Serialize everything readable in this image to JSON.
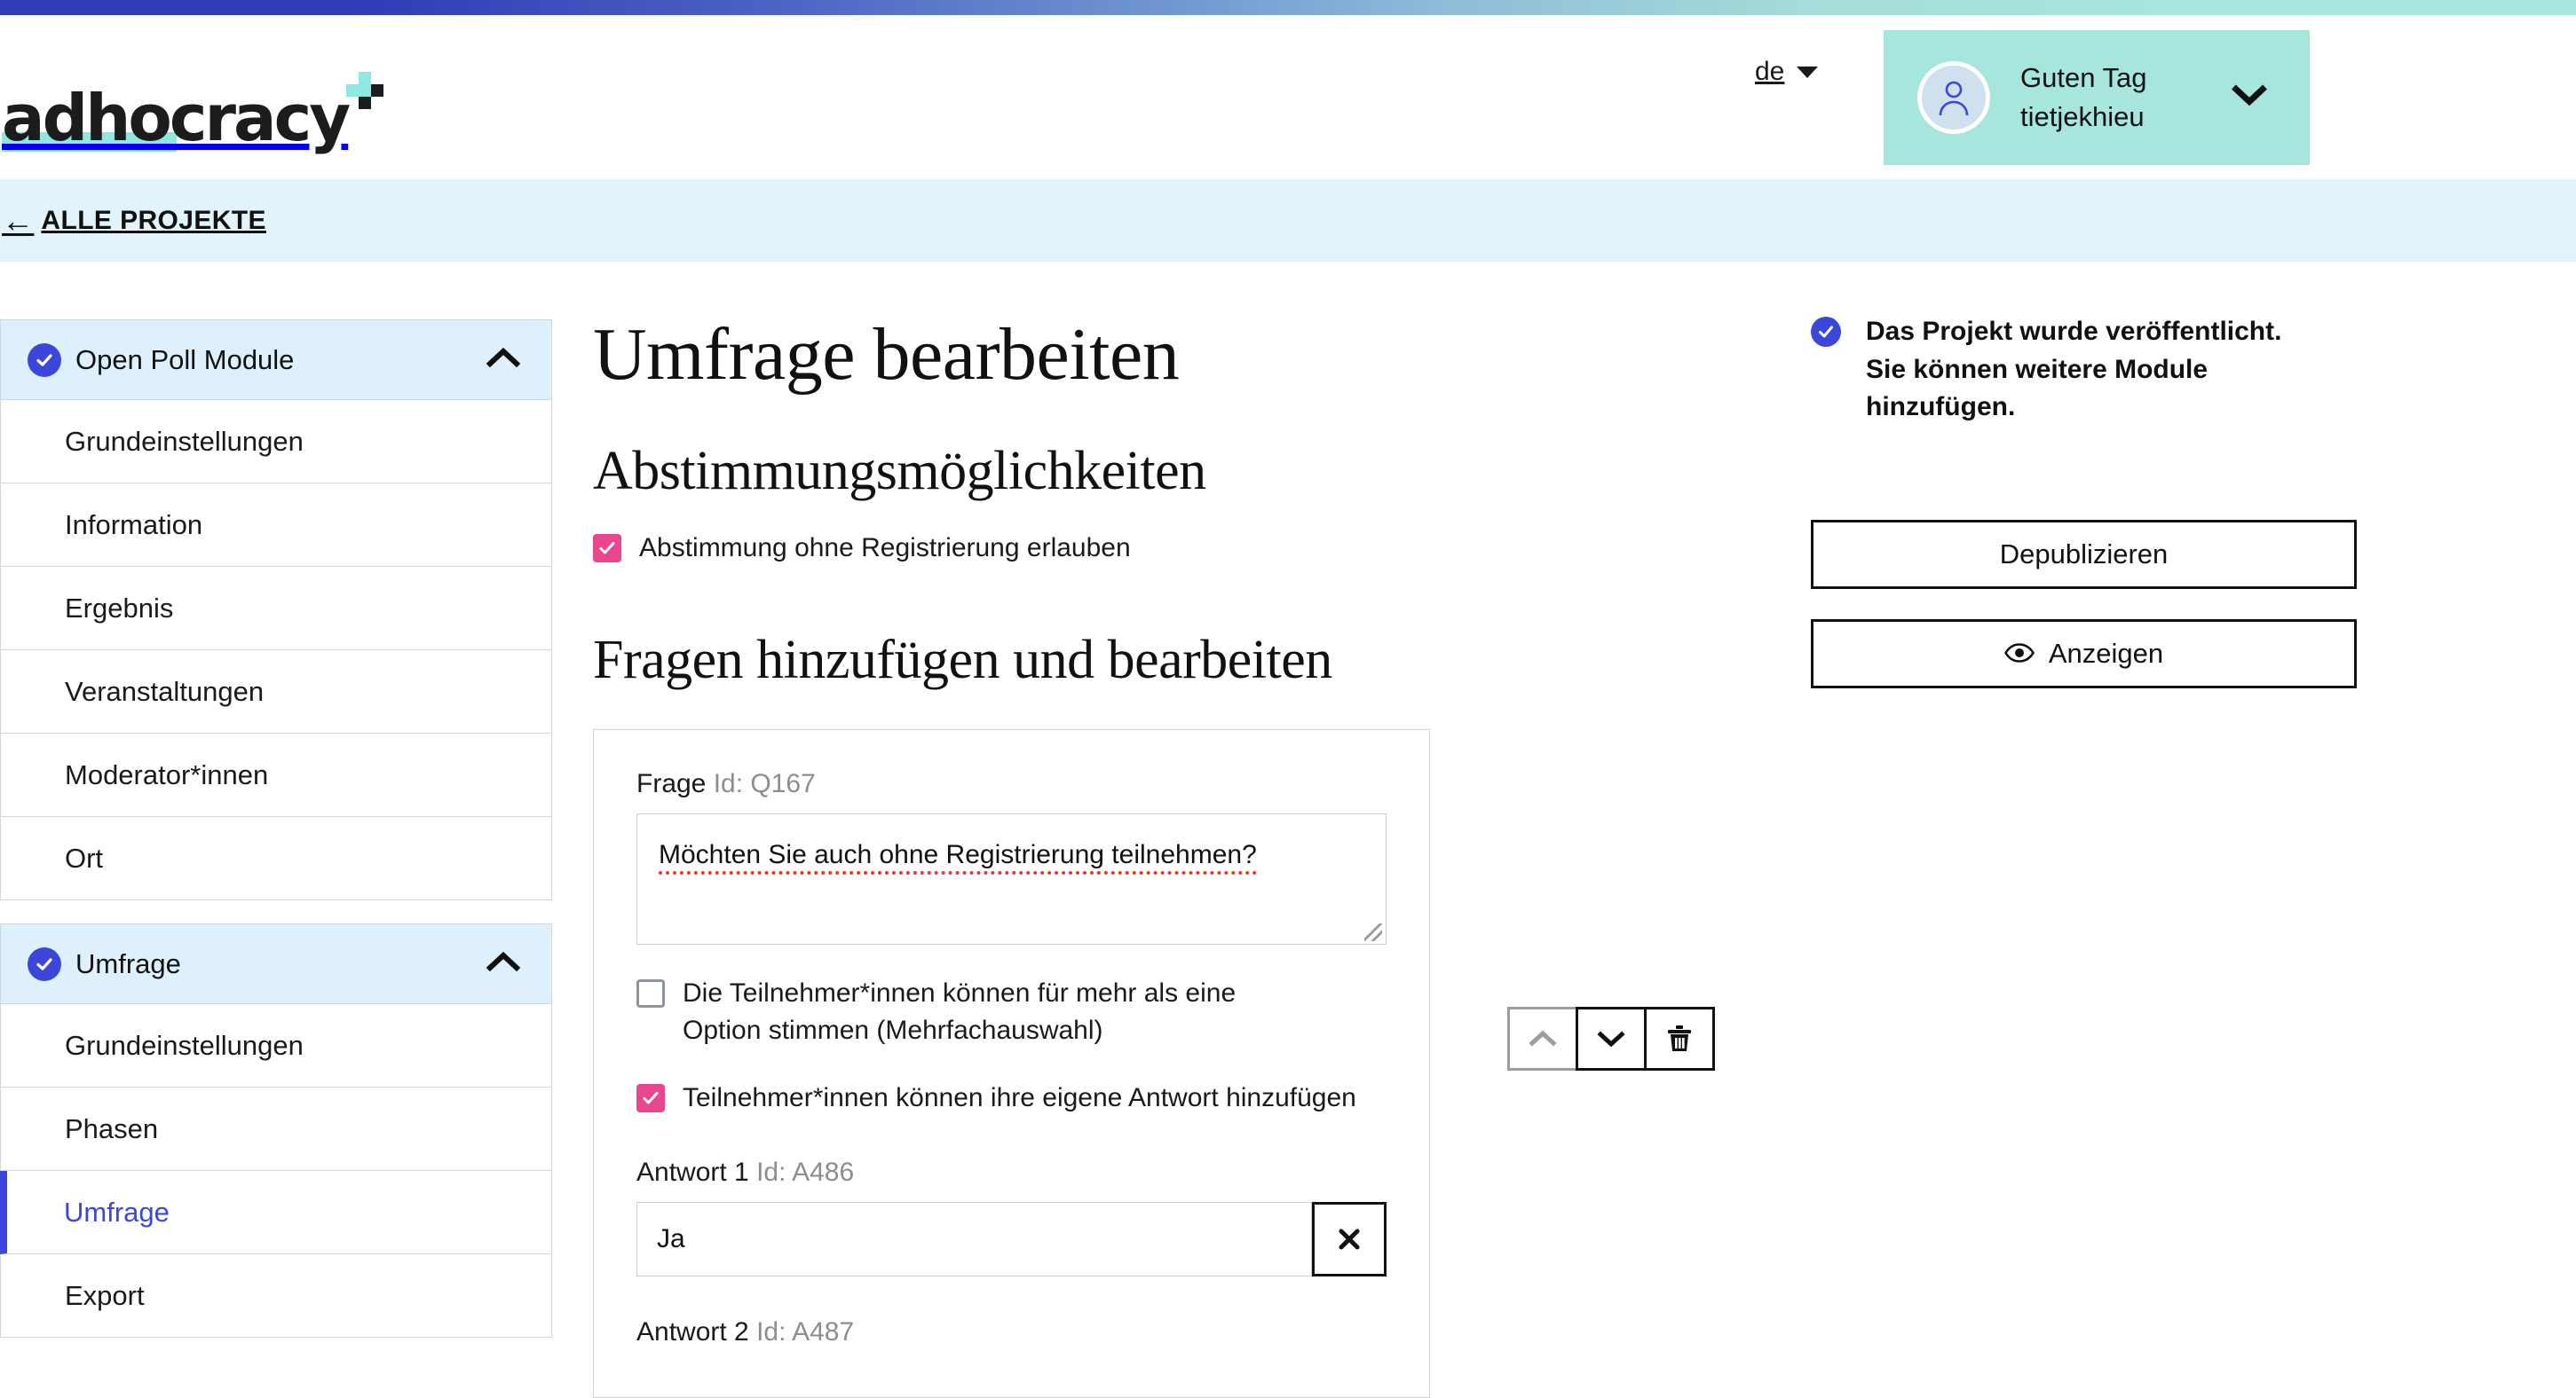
{
  "brand": {
    "logo_text": "adhocracy",
    "accent_mint": "#8fe8df",
    "accent_blue": "#3b46db",
    "accent_pink": "#e8468f"
  },
  "header": {
    "language": {
      "label": "de",
      "caret_icon": "caret-down-icon"
    },
    "user": {
      "greeting": "Guten Tag",
      "username": "tietjekhieu",
      "avatar_icon": "user-avatar-icon",
      "chevron_icon": "chevron-down-icon"
    }
  },
  "breadcrumb": {
    "back_icon": "arrow-left-icon",
    "label": "ALLE PROJEKTE"
  },
  "sidebar": {
    "groups": [
      {
        "title": "Open Poll Module",
        "status_icon": "check-circle-icon",
        "toggle_icon": "chevron-up-icon",
        "items": [
          {
            "label": "Grundeinstellungen",
            "active": false
          },
          {
            "label": "Information",
            "active": false
          },
          {
            "label": "Ergebnis",
            "active": false
          },
          {
            "label": "Veranstaltungen",
            "active": false
          },
          {
            "label": "Moderator*innen",
            "active": false
          },
          {
            "label": "Ort",
            "active": false
          }
        ]
      },
      {
        "title": "Umfrage",
        "status_icon": "check-circle-icon",
        "toggle_icon": "chevron-up-icon",
        "items": [
          {
            "label": "Grundeinstellungen",
            "active": false
          },
          {
            "label": "Phasen",
            "active": false
          },
          {
            "label": "Umfrage",
            "active": true
          },
          {
            "label": "Export",
            "active": false
          }
        ]
      }
    ]
  },
  "main": {
    "page_title": "Umfrage bearbeiten",
    "voting_section": {
      "title": "Abstimmungsmöglichkeiten",
      "allow_unregistered": {
        "label": "Abstimmung ohne Registrierung erlauben",
        "checked": true
      }
    },
    "questions_section": {
      "title": "Fragen hinzufügen und bearbeiten",
      "question": {
        "label": "Frage",
        "id_text": "Id: Q167",
        "text": "Möchten Sie auch ohne Registrierung teilnehmen?",
        "multiple_choice": {
          "label": "Die Teilnehmer*innen können für mehr als eine Option stimmen (Mehrfachauswahl)",
          "checked": false
        },
        "allow_own_answer": {
          "label": "Teilnehmer*innen können ihre eigene Antwort hinzufügen",
          "checked": true
        },
        "answers": [
          {
            "label": "Antwort 1",
            "id_text": "Id: A486",
            "value": "Ja",
            "delete_icon": "close-x-icon"
          },
          {
            "label": "Antwort 2",
            "id_text": "Id: A487",
            "value": "",
            "delete_icon": "close-x-icon"
          }
        ]
      },
      "tools": [
        {
          "name": "move-question-up",
          "icon": "chevron-up-icon",
          "disabled": true
        },
        {
          "name": "move-question-down",
          "icon": "chevron-down-icon",
          "disabled": false
        },
        {
          "name": "delete-question",
          "icon": "trash-icon",
          "disabled": false
        }
      ]
    }
  },
  "right_panel": {
    "status": {
      "icon": "check-circle-icon",
      "message": "Das Projekt wurde veröffentlicht. Sie können weitere Module hinzufügen."
    },
    "buttons": [
      {
        "label": "Depublizieren",
        "icon": null
      },
      {
        "label": "Anzeigen",
        "icon": "eye-icon"
      }
    ]
  }
}
